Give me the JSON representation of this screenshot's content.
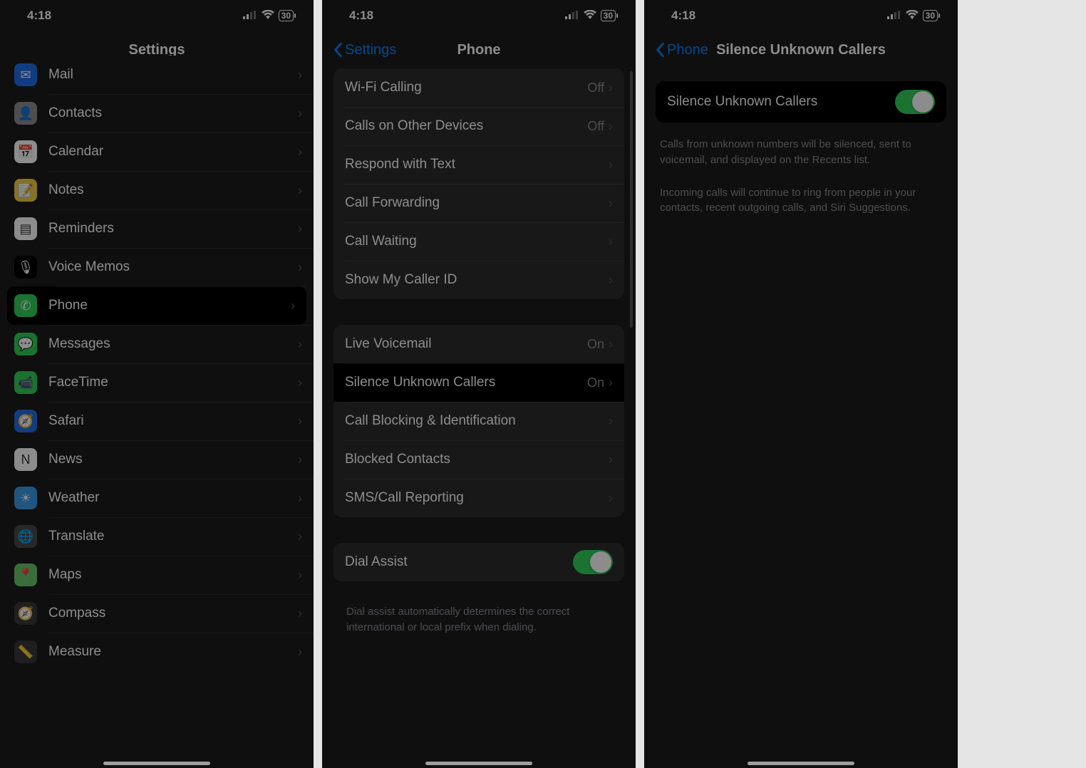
{
  "status": {
    "time": "4:18",
    "battery": "30"
  },
  "screen1": {
    "title": "Settings",
    "items": [
      {
        "label": "Mail",
        "icon_bg": "#1f6fea",
        "glyph": "✉"
      },
      {
        "label": "Contacts",
        "icon_bg": "#8e8e93",
        "glyph": "👤"
      },
      {
        "label": "Calendar",
        "icon_bg": "#ffffff",
        "glyph": "📅"
      },
      {
        "label": "Notes",
        "icon_bg": "#f7ce46",
        "glyph": "📝"
      },
      {
        "label": "Reminders",
        "icon_bg": "#ffffff",
        "glyph": "▤"
      },
      {
        "label": "Voice Memos",
        "icon_bg": "#000000",
        "glyph": "🎙"
      },
      {
        "label": "Phone",
        "icon_bg": "#30d158",
        "glyph": "✆",
        "highlight": true
      },
      {
        "label": "Messages",
        "icon_bg": "#30d158",
        "glyph": "💬"
      },
      {
        "label": "FaceTime",
        "icon_bg": "#30d158",
        "glyph": "📹"
      },
      {
        "label": "Safari",
        "icon_bg": "#1f6fea",
        "glyph": "🧭"
      },
      {
        "label": "News",
        "icon_bg": "#ffffff",
        "glyph": "N"
      },
      {
        "label": "Weather",
        "icon_bg": "#3a9be8",
        "glyph": "☀"
      },
      {
        "label": "Translate",
        "icon_bg": "#4a4a4c",
        "glyph": "🌐"
      },
      {
        "label": "Maps",
        "icon_bg": "#68c96e",
        "glyph": "📍"
      },
      {
        "label": "Compass",
        "icon_bg": "#3a3a3c",
        "glyph": "🧭"
      },
      {
        "label": "Measure",
        "icon_bg": "#3a3a3c",
        "glyph": "📏"
      }
    ]
  },
  "screen2": {
    "back": "Settings",
    "title": "Phone",
    "group1": [
      {
        "label": "Wi-Fi Calling",
        "value": "Off",
        "chevron": true
      },
      {
        "label": "Calls on Other Devices",
        "value": "Off",
        "chevron": true
      },
      {
        "label": "Respond with Text",
        "chevron": true
      },
      {
        "label": "Call Forwarding",
        "chevron": true
      },
      {
        "label": "Call Waiting",
        "chevron": true
      },
      {
        "label": "Show My Caller ID",
        "chevron": true
      }
    ],
    "group2": [
      {
        "label": "Live Voicemail",
        "value": "On",
        "chevron": true
      },
      {
        "label": "Silence Unknown Callers",
        "value": "On",
        "chevron": true,
        "highlight": true
      },
      {
        "label": "Call Blocking & Identification",
        "chevron": true
      },
      {
        "label": "Blocked Contacts",
        "chevron": true
      },
      {
        "label": "SMS/Call Reporting",
        "chevron": true
      }
    ],
    "group3": {
      "label": "Dial Assist",
      "toggle": true
    },
    "footer": "Dial assist automatically determines the correct international or local prefix when dialing."
  },
  "screen3": {
    "back": "Phone",
    "title": "Silence Unknown Callers",
    "row": {
      "label": "Silence Unknown Callers",
      "toggle": true
    },
    "desc1": "Calls from unknown numbers will be silenced, sent to voicemail, and displayed on the Recents list.",
    "desc2": "Incoming calls will continue to ring from people in your contacts, recent outgoing calls, and Siri Suggestions."
  }
}
